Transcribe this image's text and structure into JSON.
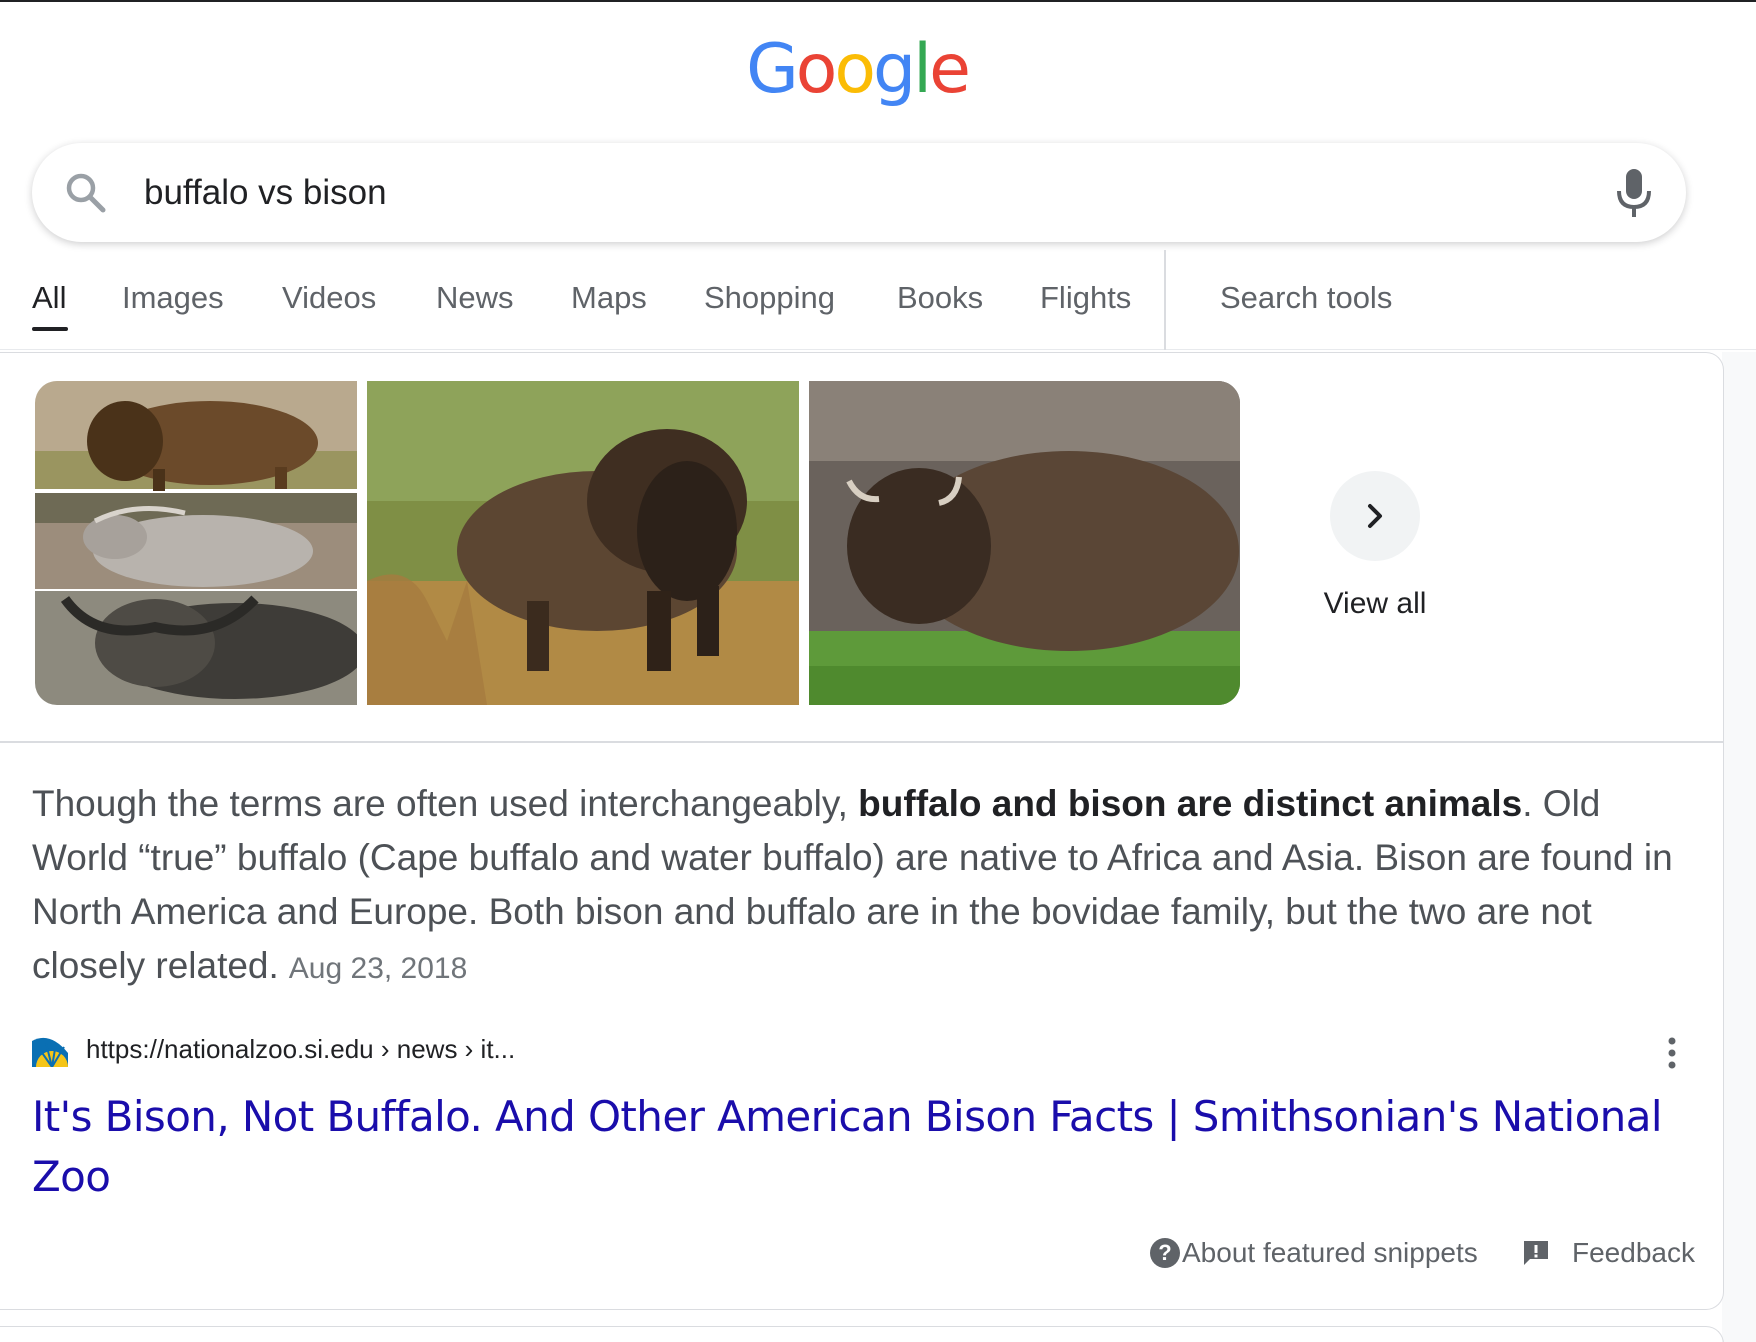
{
  "logo": {
    "letters": [
      "G",
      "o",
      "o",
      "g",
      "l",
      "e"
    ],
    "colors": [
      "#4285F4",
      "#EA4335",
      "#FBBC05",
      "#4285F4",
      "#34A853",
      "#EA4335"
    ]
  },
  "search": {
    "query": "buffalo vs bison",
    "icon": "search-icon",
    "mic_icon": "mic-icon"
  },
  "tabs": [
    {
      "label": "All",
      "active": true
    },
    {
      "label": "Images"
    },
    {
      "label": "Videos"
    },
    {
      "label": "News"
    },
    {
      "label": "Maps"
    },
    {
      "label": "Shopping"
    },
    {
      "label": "Books"
    },
    {
      "label": "Flights"
    }
  ],
  "search_tools_label": "Search tools",
  "images": {
    "tiles": [
      "buffalo-collage",
      "bison-in-meadow",
      "bison-on-grass"
    ],
    "view_all_label": "View all",
    "view_all_icon": "chevron-right-icon"
  },
  "snippet": {
    "lead": "Though the terms are often used interchangeably, ",
    "bold": "buffalo and bison are distinct animals",
    "rest": ". Old World “true” buffalo (Cape buffalo and water buffalo) are native to Africa and Asia. Bison are found in North America and Europe. Both bison and buffalo are in the bovidae family, but the two are not closely related.",
    "date": "Aug 23, 2018"
  },
  "source": {
    "url": "https://nationalzoo.si.edu › news › it...",
    "favicon": "smithsonian-sun-icon",
    "title": "It's Bison, Not Buffalo. And Other American Bison Facts | Smithsonian's National Zoo"
  },
  "footer": {
    "about_label": "About featured snippets",
    "about_icon": "help-circle-icon",
    "feedback_label": "Feedback",
    "feedback_icon": "feedback-icon"
  },
  "colors": {
    "link": "#1a0dab",
    "text": "#202124",
    "muted": "#5f6368",
    "snippet": "#4d5156"
  }
}
